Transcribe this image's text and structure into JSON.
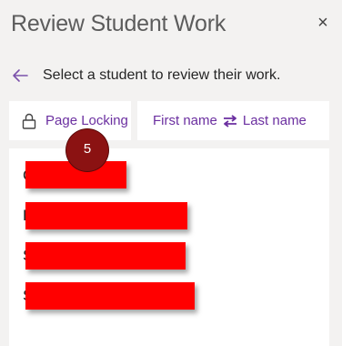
{
  "panel": {
    "title": "Review Student Work",
    "close_glyph": "×",
    "instruction": "Select a student to review their work."
  },
  "icons": {
    "back": "arrow-left-icon",
    "lock": "lock-icon",
    "swap": "swap-arrows-icon",
    "close": "close-icon"
  },
  "toolbar": {
    "lock_label": "Page Locking",
    "sort_first": "First name",
    "sort_last": "Last name"
  },
  "badge": {
    "value": "5"
  },
  "students": [
    {
      "initial": "C"
    },
    {
      "initial": "H"
    },
    {
      "initial": "S"
    },
    {
      "initial": "S"
    }
  ],
  "colors": {
    "accent": "#6b2fa0",
    "redaction": "#ff0000",
    "badge": "#8b1212",
    "background": "#f3f2f1"
  }
}
